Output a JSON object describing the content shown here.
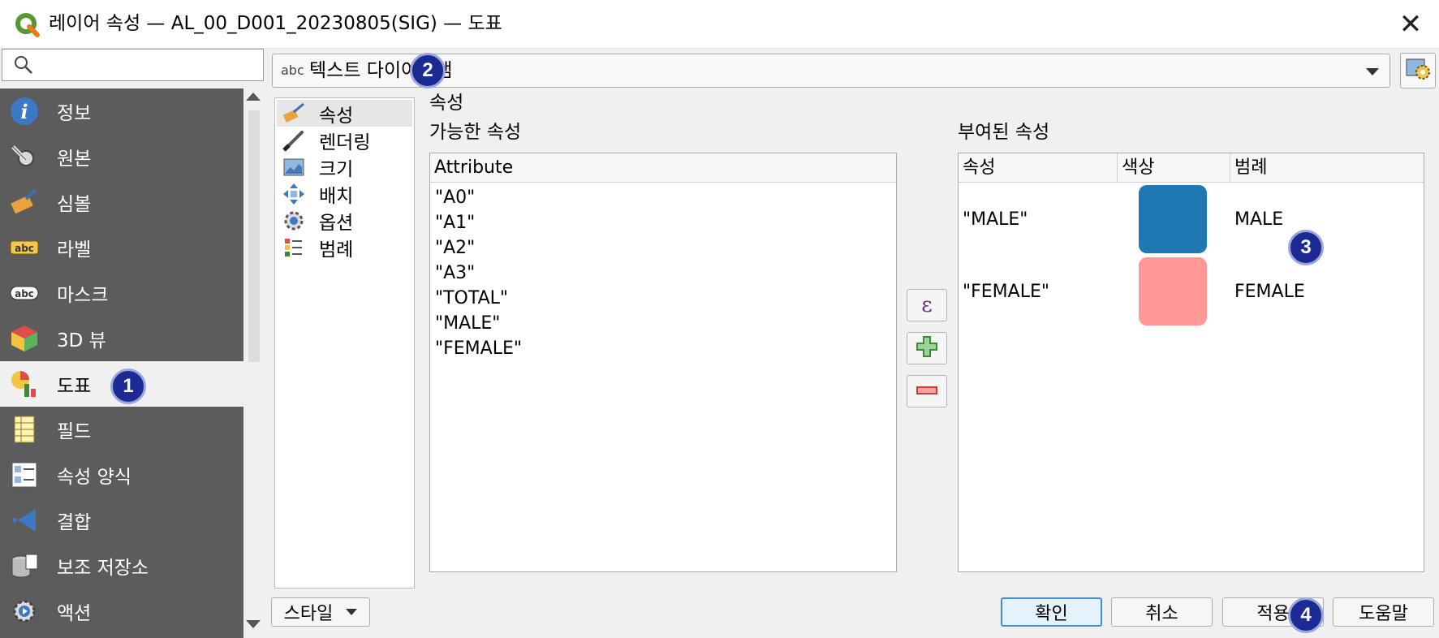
{
  "window": {
    "title": "레이어 속성 — AL_00_D001_20230805(SIG) — 도표",
    "close_symbol": "✕"
  },
  "sidebar": {
    "items": [
      {
        "label": "정보",
        "icon": "info-icon"
      },
      {
        "label": "원본",
        "icon": "source-wrench-icon"
      },
      {
        "label": "심볼",
        "icon": "symbology-paintbrush-icon"
      },
      {
        "label": "라벨",
        "icon": "labels-abc-icon"
      },
      {
        "label": "마스크",
        "icon": "mask-abc-icon"
      },
      {
        "label": "3D 뷰",
        "icon": "3d-cube-icon"
      },
      {
        "label": "도표",
        "icon": "diagram-chart-icon",
        "active": true
      },
      {
        "label": "필드",
        "icon": "fields-table-icon"
      },
      {
        "label": "속성 양식",
        "icon": "attributes-form-icon"
      },
      {
        "label": "결합",
        "icon": "joins-icon"
      },
      {
        "label": "보조 저장소",
        "icon": "auxiliary-storage-icon"
      },
      {
        "label": "액션",
        "icon": "actions-gear-icon"
      }
    ]
  },
  "diagram_type": {
    "prefix": "abc",
    "value": "텍스트 다이어그램"
  },
  "subnav": {
    "items": [
      {
        "label": "속성",
        "icon": "attributes-brush-icon",
        "active": true
      },
      {
        "label": "렌더링",
        "icon": "rendering-brush-icon"
      },
      {
        "label": "크기",
        "icon": "size-icon"
      },
      {
        "label": "배치",
        "icon": "placement-icon"
      },
      {
        "label": "옵션",
        "icon": "options-icon"
      },
      {
        "label": "범례",
        "icon": "legend-icon"
      }
    ]
  },
  "section_title": "속성",
  "available": {
    "label": "가능한 속성",
    "header": "Attribute",
    "rows": [
      "\"A0\"",
      "\"A1\"",
      "\"A2\"",
      "\"A3\"",
      "\"TOTAL\"",
      "\"MALE\"",
      "\"FEMALE\""
    ]
  },
  "middle_buttons": {
    "expression_symbol": "ε"
  },
  "assigned": {
    "label": "부여된 속성",
    "headers": {
      "attribute": "속성",
      "color": "색상",
      "legend": "범례"
    },
    "rows": [
      {
        "attribute": "\"MALE\"",
        "color": "#1f77b4",
        "legend": "MALE"
      },
      {
        "attribute": "\"FEMALE\"",
        "color": "#ff9896",
        "legend": "FEMALE"
      }
    ]
  },
  "footer": {
    "style_label": "스타일",
    "ok": "확인",
    "cancel": "취소",
    "apply": "적용",
    "help": "도움말"
  },
  "markers": [
    "1",
    "2",
    "3",
    "4"
  ],
  "colors": {
    "sidebar_bg": "#5c5c5c",
    "marker_bg": "#1c2a93",
    "default_button_border": "#3b8fd6"
  }
}
